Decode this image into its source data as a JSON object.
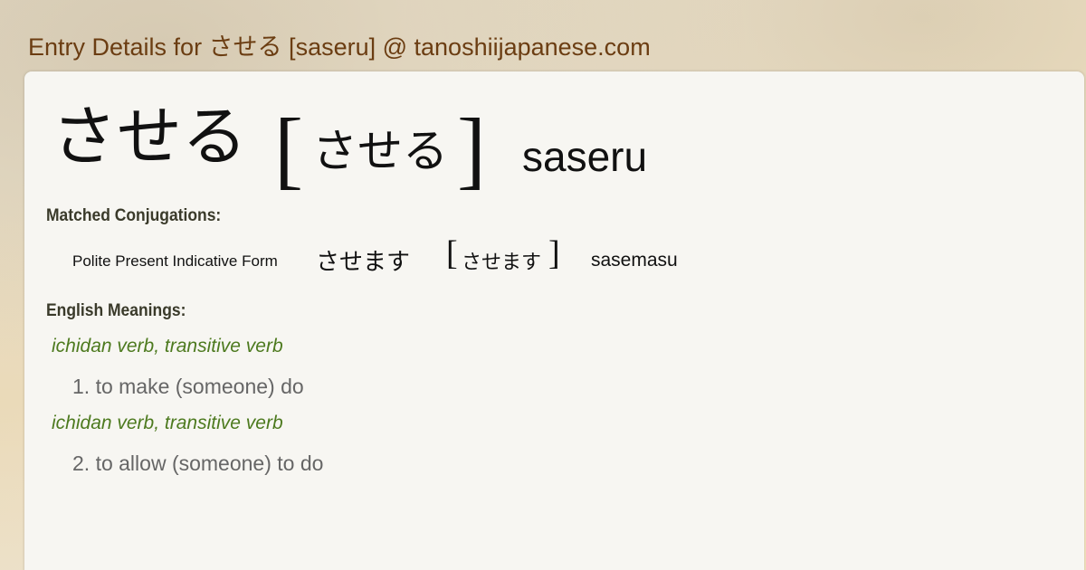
{
  "page": {
    "title": "Entry Details for させる [saseru] @ tanoshiijapanese.com"
  },
  "entry": {
    "word": "させる",
    "reading": "させる",
    "romaji": "saseru"
  },
  "conjugations": {
    "heading": "Matched Conjugations:",
    "items": [
      {
        "form": "Polite Present Indicative Form",
        "word": "させます",
        "reading": "させます",
        "romaji": "sasemasu"
      }
    ]
  },
  "meanings": {
    "heading": "English Meanings:",
    "items": [
      {
        "pos": "ichidan verb, transitive verb",
        "text": "1. to make (someone) do"
      },
      {
        "pos": "ichidan verb, transitive verb",
        "text": "2. to allow (someone) to do"
      }
    ]
  },
  "colors": {
    "title": "#6b3d12",
    "pos": "#4d7a1f",
    "meaning": "#666666",
    "heading": "#3a3a2a",
    "card": "#f7f6f2"
  }
}
